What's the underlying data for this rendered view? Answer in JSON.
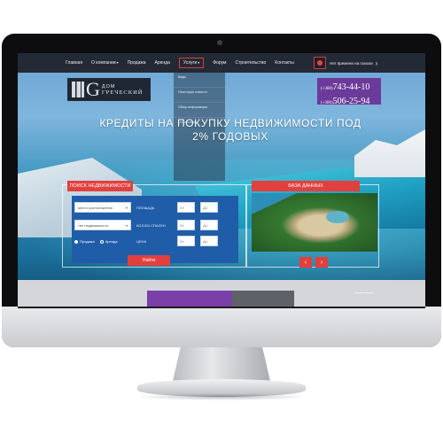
{
  "nav": {
    "items": [
      {
        "label": "Главная"
      },
      {
        "label": "О компании"
      },
      {
        "label": "Продажа"
      },
      {
        "label": "Аренда"
      },
      {
        "label": "Услуги"
      },
      {
        "label": "Форум"
      },
      {
        "label": "Строительство"
      },
      {
        "label": "Контакты"
      }
    ],
    "search_text": "Нет времени на поиски"
  },
  "dropdown": {
    "items": [
      {
        "label": "Виды"
      },
      {
        "label": "Некоторые новости"
      },
      {
        "label": "Обзор информации"
      },
      {
        "label": "Об условиях"
      }
    ]
  },
  "logo": {
    "letter": "G",
    "line1": "ДОМ",
    "line2": "ГРЕЧЕСКИЙ"
  },
  "phones": [
    {
      "code": "(+380)",
      "number": "743-44-10"
    },
    {
      "code": "(+380)",
      "number": "506-25-94"
    }
  ],
  "headline": "КРЕДИТЫ НА ПОКУПКУ НЕДВИЖИМОСТИ ПОД 2% ГОДОВЫХ",
  "search": {
    "title": "ПОИСК НЕДВИЖИМОСТИ",
    "location_select": "место расположения",
    "type_select": "тип недвижимости",
    "area_label": "ПЛОЩАДЬ",
    "rooms_label": "КОЛ-ВО СПАЛЕН",
    "price_label": "ЦЕНА",
    "from_placeholder": "От",
    "to_placeholder": "До",
    "radio_sale": "Продажа",
    "radio_rent": "Аренда",
    "find_button": "Найти"
  },
  "database": {
    "title": "БАЗА ДАННЫХ",
    "prev": "‹",
    "next": "›"
  },
  "colors": {
    "accent_red": "#e2403e",
    "purple": "#6b3a9a",
    "panel_blue": "#1f5da8"
  }
}
